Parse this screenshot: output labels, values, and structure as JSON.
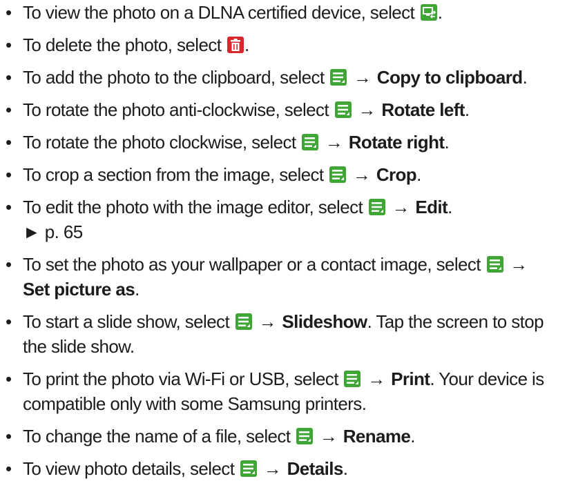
{
  "colors": {
    "icon_green": "#3fa535",
    "icon_red": "#d7262c",
    "text": "#1c1c1c"
  },
  "items": [
    {
      "pre": "To view the photo on a DLNA certified device, select ",
      "icon": "dlna-share-icon",
      "post": "."
    },
    {
      "pre": "To delete the photo, select ",
      "icon": "delete-icon",
      "post": "."
    },
    {
      "pre": "To add the photo to the clipboard, select ",
      "icon": "menu-icon",
      "arrow": "→",
      "bold": "Copy to clipboard",
      "post": "."
    },
    {
      "pre": "To rotate the photo anti-clockwise, select ",
      "icon": "menu-icon",
      "arrow": "→",
      "bold": "Rotate left",
      "post": "."
    },
    {
      "pre": "To rotate the photo clockwise, select ",
      "icon": "menu-icon",
      "arrow": "→",
      "bold": "Rotate right",
      "post": "."
    },
    {
      "pre": "To crop a section from the image, select ",
      "icon": "menu-icon",
      "arrow": "→",
      "bold": "Crop",
      "post": "."
    },
    {
      "pre": "To edit the photo with the image editor, select ",
      "icon": "menu-icon",
      "arrow": "→",
      "bold": "Edit",
      "post": ".",
      "ref": "► p. 65"
    },
    {
      "pre": "To set the photo as your wallpaper or a contact image, select ",
      "icon": "menu-icon",
      "arrow": "→",
      "bold": "Set picture as",
      "post": "."
    },
    {
      "pre": "To start a slide show, select ",
      "icon": "menu-icon",
      "arrow": "→",
      "bold": "Slideshow",
      "post": ". Tap the screen to stop the slide show."
    },
    {
      "pre": "To print the photo via Wi-Fi or USB, select ",
      "icon": "menu-icon",
      "arrow": "→",
      "bold": "Print",
      "post": ". Your device is compatible only with some Samsung printers."
    },
    {
      "pre": "To change the name of a file, select ",
      "icon": "menu-icon",
      "arrow": "→",
      "bold": "Rename",
      "post": "."
    },
    {
      "pre": "To view photo details, select ",
      "icon": "menu-icon",
      "arrow": "→",
      "bold": "Details",
      "post": "."
    }
  ]
}
